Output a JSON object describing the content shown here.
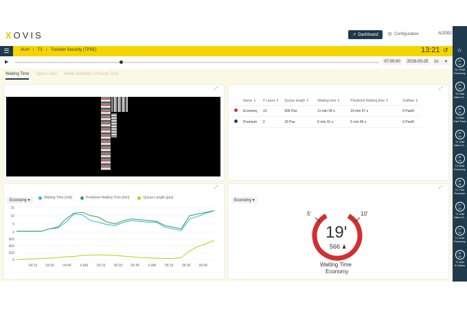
{
  "header": {
    "logo": "XOVIS",
    "dashboard_label": "Dashboard",
    "configuration_label": "Configuration",
    "user": "AODB2"
  },
  "breadcrumb": {
    "item1": "AUH",
    "item2": "T3",
    "item3": "Transfer Security (TPSE)"
  },
  "clock": "13:21",
  "playback": {
    "time": "07:00:00",
    "date": "2018-03-25",
    "speed": "1x"
  },
  "tabs": [
    {
      "label": "Waiting Time"
    },
    {
      "label": "Open Lines"
    },
    {
      "label": "Metal Detectors Process Time"
    }
  ],
  "table": {
    "headers": [
      "Name",
      "# Lanes",
      "Queue length",
      "Waiting time",
      "Predicted Waiting time",
      "Outflow"
    ],
    "rows": [
      {
        "color": "#d32f2f",
        "name": "Economy",
        "lanes": "13",
        "queue": "566 Pax",
        "wait": "11 min 34 s",
        "pred": "19 min 57 s",
        "outflow": "0 Pax/h"
      },
      {
        "color": "#1f3a8a",
        "name": "Premium",
        "lanes": "2",
        "queue": "32 Pax",
        "wait": "6 min 31 s",
        "pred": "5 min 56 s",
        "outflow": "0 Pax/h"
      }
    ]
  },
  "chart_panel": {
    "select": "Economy",
    "legend": [
      "Waiting Time [min]",
      "Predicted Waiting Time [min]",
      "Queue Length [pax]"
    ]
  },
  "chart_data": {
    "type": "line",
    "x": [
      "04:15",
      "04:30",
      "04:45",
      "5 AM",
      "05:15",
      "05:30",
      "05:45",
      "6 AM",
      "06:15",
      "06:30",
      "06:45"
    ],
    "top": {
      "yticks": [
        "15",
        "10",
        "5",
        "0"
      ],
      "ylim": [
        0,
        15
      ],
      "series": [
        {
          "name": "Waiting Time [min]",
          "color": "#29b6d8",
          "values": [
            0.5,
            0.5,
            0.5,
            0.5,
            2,
            2.5,
            6,
            11,
            10.5,
            7,
            6,
            4.5,
            4,
            6,
            7,
            6.5,
            6,
            6,
            3,
            2,
            1,
            8,
            9.5,
            11.5,
            13
          ]
        },
        {
          "name": "Predicted Waiting Time [min]",
          "color": "#2e9e5a",
          "values": [
            0.5,
            0.5,
            0.5,
            0.5,
            2,
            3,
            8,
            11.5,
            12,
            10,
            9,
            6,
            5,
            7,
            8,
            7.5,
            7,
            6.5,
            4,
            3,
            2,
            10,
            11,
            12,
            13
          ]
        }
      ]
    },
    "bottom": {
      "yticks": [
        "600",
        "400",
        "200",
        "0"
      ],
      "ylim": [
        0,
        600
      ],
      "series": [
        {
          "name": "Queue Length [pax]",
          "color": "#c9c415",
          "values": [
            0,
            10,
            20,
            30,
            40,
            60,
            80,
            90,
            120,
            130,
            140,
            130,
            120,
            100,
            80,
            60,
            50,
            40,
            30,
            30,
            60,
            250,
            380,
            460,
            560
          ]
        }
      ]
    }
  },
  "gauge_panel": {
    "select": "Economy",
    "label_low": "5'",
    "label_high": "10'",
    "value": "19'",
    "pax": "566",
    "caption": "Waiting Time",
    "subcaption": "Economy",
    "ring_color": "#d32f2f"
  },
  "sidebar": [
    {
      "top": "22'",
      "bottom": "14",
      "l1": "T3 TPSE",
      "l2": "Economy"
    },
    {
      "top": "21'",
      "bottom": "04",
      "l1": "T3 DIM",
      "l2": "Other N..."
    },
    {
      "top": "20'",
      "bottom": "02",
      "l1": "T3 AIM",
      "l2": "Fast Track"
    },
    {
      "top": "19'",
      "bottom": "04",
      "l1": "T1 DIM",
      "l2": "Other N..."
    },
    {
      "top": "18'",
      "bottom": "14",
      "l1": "T3 DSE",
      "l2": "Economy"
    },
    {
      "top": "18'",
      "bottom": "05",
      "l1": "T1 TSE",
      "l2": "Premium"
    },
    {
      "top": "17'",
      "bottom": "03",
      "l1": "T1 DIM",
      "l2": "Other N..."
    },
    {
      "top": "17'",
      "bottom": "04",
      "l1": "T1 DSE",
      "l2": "Economy"
    },
    {
      "top": "16'",
      "bottom": "04",
      "l1": "T1 AIM",
      "l2": "E-Gates"
    }
  ]
}
